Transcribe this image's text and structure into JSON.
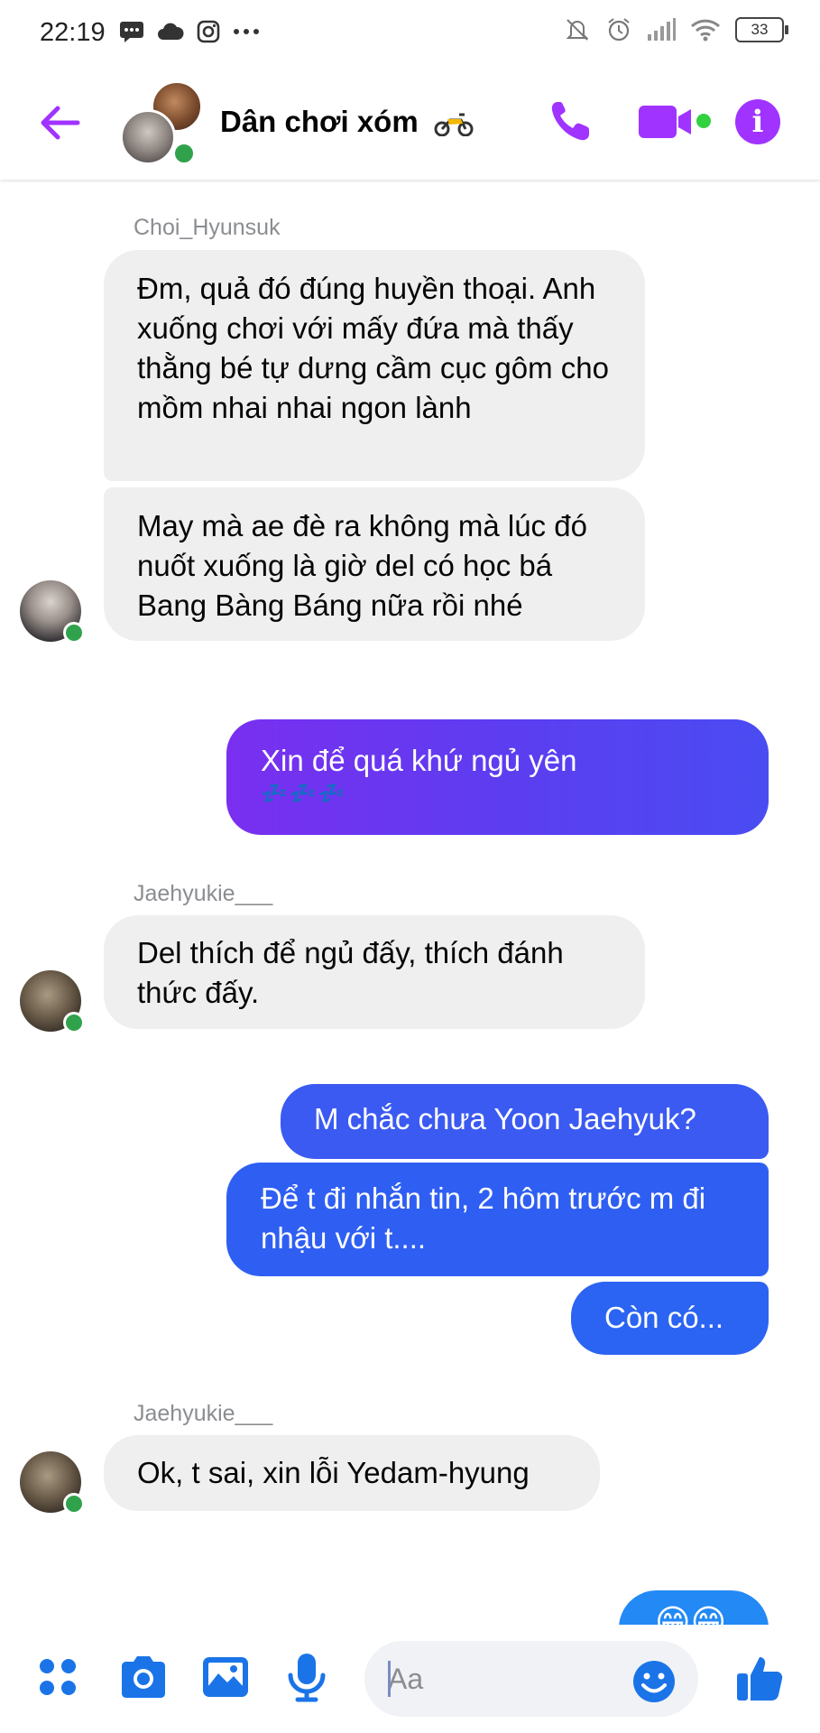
{
  "status_bar": {
    "time": "22:19",
    "left_icons": [
      "message-icon",
      "cloud-icon",
      "instagram-icon",
      "more-dots-icon"
    ],
    "right_icons": [
      "mute-icon",
      "alarm-icon",
      "signal-icon",
      "wifi-icon"
    ],
    "battery": "33"
  },
  "header": {
    "title": "Dân chơi xóm",
    "title_icon": "motorcycle-icon",
    "back_icon": "back-arrow-icon",
    "call_icon": "phone-icon",
    "video_icon": "video-camera-icon",
    "info_icon": "info-icon",
    "info_glyph": "i",
    "accent_color": "#a033ff"
  },
  "messages": [
    {
      "type": "sender",
      "name": "Choi_Hyunsuk"
    },
    {
      "type": "incoming",
      "text": "Đm, quả đó đúng huyền thoại. Anh xuống chơi với mấy đứa mà thấy thằng bé tự dưng cầm cục gôm cho mồm nhai nhai ngon lành"
    },
    {
      "type": "incoming",
      "text": "May mà ae đè ra không mà lúc đó nuốt xuống là giờ del có học bá Bang Bàng Báng nữa rồi nhé"
    },
    {
      "type": "outgoing",
      "text": "Xin để quá khứ ngủ yên",
      "emoji": "💤💤💤"
    },
    {
      "type": "sender",
      "name": "Jaehyukie___"
    },
    {
      "type": "incoming",
      "text": "Del thích để ngủ đấy, thích đánh thức đấy."
    },
    {
      "type": "outgoing",
      "text": "M chắc chưa Yoon Jaehyuk?"
    },
    {
      "type": "outgoing",
      "text": "Để t đi nhắn tin, 2 hôm trước m đi nhậu với t...."
    },
    {
      "type": "outgoing",
      "text": "Còn có..."
    },
    {
      "type": "sender",
      "name": "Jaehyukie___"
    },
    {
      "type": "incoming",
      "text": "Ok, t sai, xin lỗi Yedam-hyung"
    },
    {
      "type": "outgoing",
      "text": "😁😁"
    }
  ],
  "composer": {
    "placeholder": "Aa",
    "icons": [
      "menu-dots-icon",
      "camera-icon",
      "gallery-icon",
      "microphone-icon",
      "emoji-icon",
      "thumbs-up-icon"
    ]
  },
  "colors": {
    "incoming_bubble": "#efefef",
    "outgoing_purple": "#5b3ef0",
    "outgoing_blue": "#2d63f2",
    "icon_blue": "#1a74e8",
    "online_green": "#31a24c"
  }
}
